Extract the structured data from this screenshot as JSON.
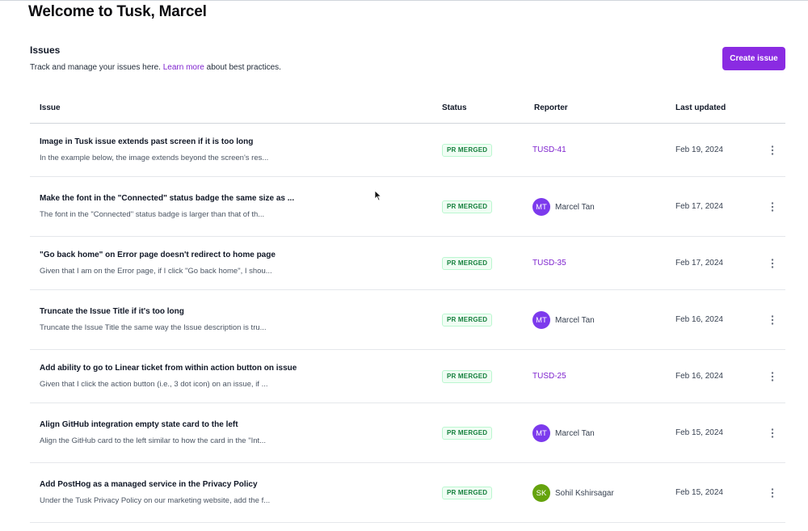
{
  "header": {
    "welcome": "Welcome to Tusk, Marcel"
  },
  "section": {
    "title": "Issues",
    "subtitle_before": "Track and manage your issues here. ",
    "learn_more": "Learn more",
    "subtitle_after": " about best practices.",
    "create_button": "Create issue"
  },
  "colors": {
    "accent": "#8a2be2",
    "link": "#7e22ce",
    "badge_text": "#15803d",
    "avatar_mt": "#7c3aed",
    "avatar_sk": "#65a30d"
  },
  "table": {
    "columns": {
      "issue": "Issue",
      "status": "Status",
      "reporter": "Reporter",
      "updated": "Last updated"
    },
    "rows": [
      {
        "title": "Image in Tusk issue extends past screen if it is too long",
        "desc": "In the example below, the image extends beyond the screen's res...",
        "status": "PR MERGED",
        "reporter_type": "link",
        "reporter": "TUSD-41",
        "updated": "Feb 19, 2024"
      },
      {
        "title": "Make the font in the \"Connected\" status badge the same size as ...",
        "desc": "The font in the \"Connected\" status badge is larger than that of th...",
        "status": "PR MERGED",
        "reporter_type": "user",
        "initials": "MT",
        "reporter": "Marcel Tan",
        "updated": "Feb 17, 2024"
      },
      {
        "title": "\"Go back home\" on Error page doesn't redirect to home page",
        "desc": "Given that I am on the Error page, if I click \"Go back home\", I shou...",
        "status": "PR MERGED",
        "reporter_type": "link",
        "reporter": "TUSD-35",
        "updated": "Feb 17, 2024"
      },
      {
        "title": "Truncate the Issue Title if it's too long",
        "desc": "Truncate the Issue Title the same way the Issue description is tru...",
        "status": "PR MERGED",
        "reporter_type": "user",
        "initials": "MT",
        "reporter": "Marcel Tan",
        "updated": "Feb 16, 2024"
      },
      {
        "title": "Add ability to go to Linear ticket from within action button on issue",
        "desc": "Given that I click the action button (i.e., 3 dot icon) on an issue, if ...",
        "status": "PR MERGED",
        "reporter_type": "link",
        "reporter": "TUSD-25",
        "updated": "Feb 16, 2024"
      },
      {
        "title": "Align GitHub integration empty state card to the left",
        "desc": "Align the GitHub card to the left similar to how the card in the \"Int...",
        "status": "PR MERGED",
        "reporter_type": "user",
        "initials": "MT",
        "reporter": "Marcel Tan",
        "updated": "Feb 15, 2024"
      },
      {
        "title": "Add PostHog as a managed service in the Privacy Policy",
        "desc": "Under the Tusk Privacy Policy on our marketing website, add the f...",
        "status": "PR MERGED",
        "reporter_type": "user",
        "initials": "SK",
        "reporter": "Sohil Kshirsagar",
        "updated": "Feb 15, 2024"
      }
    ]
  }
}
